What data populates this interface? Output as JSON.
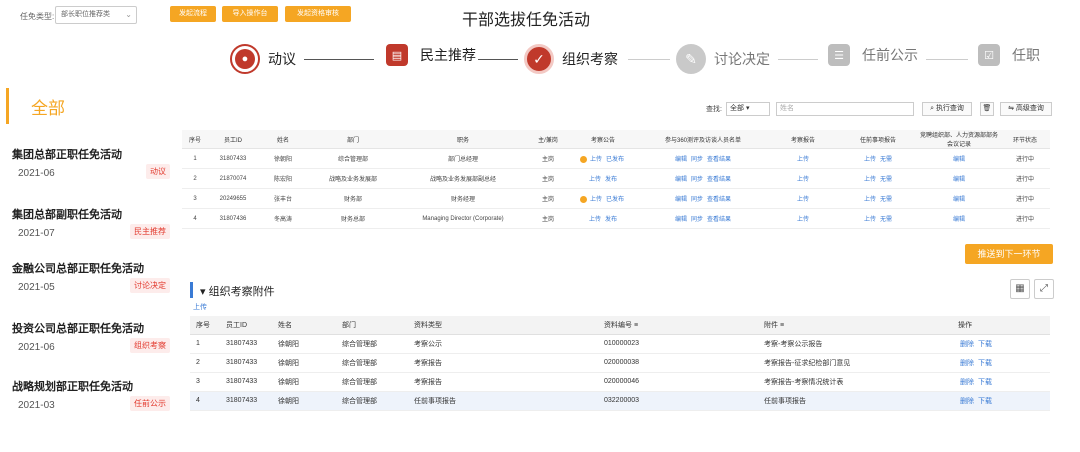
{
  "topbar": {
    "filter_label": "任免类型:",
    "filter_value": "部长职位推荐类",
    "buttons": [
      "发起流程",
      "导入操作台",
      "发起资格审核"
    ],
    "title": "干部选拔任免活动"
  },
  "steps": [
    {
      "label": "动议",
      "state": "done",
      "icon": "person-icon"
    },
    {
      "label": "民主推荐",
      "state": "done",
      "icon": "ballot-icon"
    },
    {
      "label": "组织考察",
      "state": "active",
      "icon": "clipboard-icon"
    },
    {
      "label": "讨论决定",
      "state": "pending",
      "icon": "pen-icon"
    },
    {
      "label": "任前公示",
      "state": "pending",
      "icon": "list-icon"
    },
    {
      "label": "任职",
      "state": "pending",
      "icon": "checkbox-icon"
    }
  ],
  "left": {
    "all_label": "全部",
    "activities": [
      {
        "title": "集团总部正职任免活动",
        "date": "2021-06",
        "badge": "动议"
      },
      {
        "title": "集团总部副职任免活动",
        "date": "2021-07",
        "badge": "民主推荐"
      },
      {
        "title": "金融公司总部正职任免活动",
        "date": "2021-05",
        "badge": "讨论决定"
      },
      {
        "title": "投资公司总部正职任免活动",
        "date": "2021-06",
        "badge": "组织考察"
      },
      {
        "title": "战略规划部正职任免活动",
        "date": "2021-03",
        "badge": "任前公示"
      }
    ]
  },
  "search": {
    "label": "查找:",
    "select_value": "全部",
    "placeholder": "姓名",
    "execute_label": "执行查询",
    "advanced_label": "高级查询"
  },
  "table1": {
    "headers": [
      "序号",
      "员工ID",
      "姓名",
      "部门",
      "职务",
      "主/兼岗",
      "考察公告",
      "参与360测评及访谈人员名单",
      "考察报告",
      "任前事项报告",
      "竞聘组织部、人力资源部部务会议记录",
      "环节状态"
    ],
    "rows": [
      {
        "no": "1",
        "id": "31807433",
        "name": "徐朝阳",
        "dept": "综合管理部",
        "title": "部门总经理",
        "post": "主岗",
        "notice": [
          "上传",
          "已发布"
        ],
        "notice_dot": true,
        "list": [
          "编辑",
          "同步",
          "查看结果"
        ],
        "report": "上传",
        "matters": [
          "上传",
          "无需"
        ],
        "minutes": "编辑",
        "status": "进行中"
      },
      {
        "no": "2",
        "id": "21870074",
        "name": "陈宏阳",
        "dept": "战略及业务发展部",
        "title": "战略及业务发展部副总经",
        "post": "主岗",
        "notice": [
          "上传",
          "发布"
        ],
        "notice_dot": false,
        "list": [
          "编辑",
          "同步",
          "查看结果"
        ],
        "report": "上传",
        "matters": [
          "上传",
          "无需"
        ],
        "minutes": "编辑",
        "status": "进行中"
      },
      {
        "no": "3",
        "id": "20249655",
        "name": "张丰台",
        "dept": "财务部",
        "title": "财务经理",
        "post": "主岗",
        "notice": [
          "上传",
          "已发布"
        ],
        "notice_dot": true,
        "list": [
          "编辑",
          "同步",
          "查看结果"
        ],
        "report": "上传",
        "matters": [
          "上传",
          "无需"
        ],
        "minutes": "编辑",
        "status": "进行中"
      },
      {
        "no": "4",
        "id": "31807436",
        "name": "冬高涛",
        "dept": "财务总部",
        "title": "Managing Director (Corporate)",
        "post": "主岗",
        "notice": [
          "上传",
          "发布"
        ],
        "notice_dot": false,
        "list": [
          "编辑",
          "同步",
          "查看结果"
        ],
        "report": "上传",
        "matters": [
          "上传",
          "无需"
        ],
        "minutes": "编辑",
        "status": "进行中"
      }
    ]
  },
  "push_button": "推送到下一环节",
  "attachments": {
    "title": "组织考察附件",
    "upload_label": "上传",
    "headers": [
      "序号",
      "员工ID",
      "姓名",
      "部门",
      "资料类型",
      "资料编号 ≡",
      "附件 ≡",
      "操作"
    ],
    "rows": [
      {
        "no": "1",
        "id": "31807433",
        "name": "徐朝阳",
        "dept": "综合管理部",
        "type": "考察公示",
        "code": "010000023",
        "file": "考察-考察公示报告",
        "ops": [
          "删除",
          "下载"
        ]
      },
      {
        "no": "2",
        "id": "31807433",
        "name": "徐朝阳",
        "dept": "综合管理部",
        "type": "考察报告",
        "code": "020000038",
        "file": "考察报告-征求纪检部门意见",
        "ops": [
          "删除",
          "下载"
        ]
      },
      {
        "no": "3",
        "id": "31807433",
        "name": "徐朝阳",
        "dept": "综合管理部",
        "type": "考察报告",
        "code": "020000046",
        "file": "考察报告-考察情况统计表",
        "ops": [
          "删除",
          "下载"
        ]
      },
      {
        "no": "4",
        "id": "31807433",
        "name": "徐朝阳",
        "dept": "综合管理部",
        "type": "任前事项报告",
        "code": "032200003",
        "file": "任前事项报告",
        "ops": [
          "删除",
          "下载"
        ]
      }
    ]
  },
  "colors": {
    "accent": "#f5a623",
    "primary_red": "#c0392b",
    "link": "#3a7bd5",
    "badge_red": "#e23a2e"
  }
}
